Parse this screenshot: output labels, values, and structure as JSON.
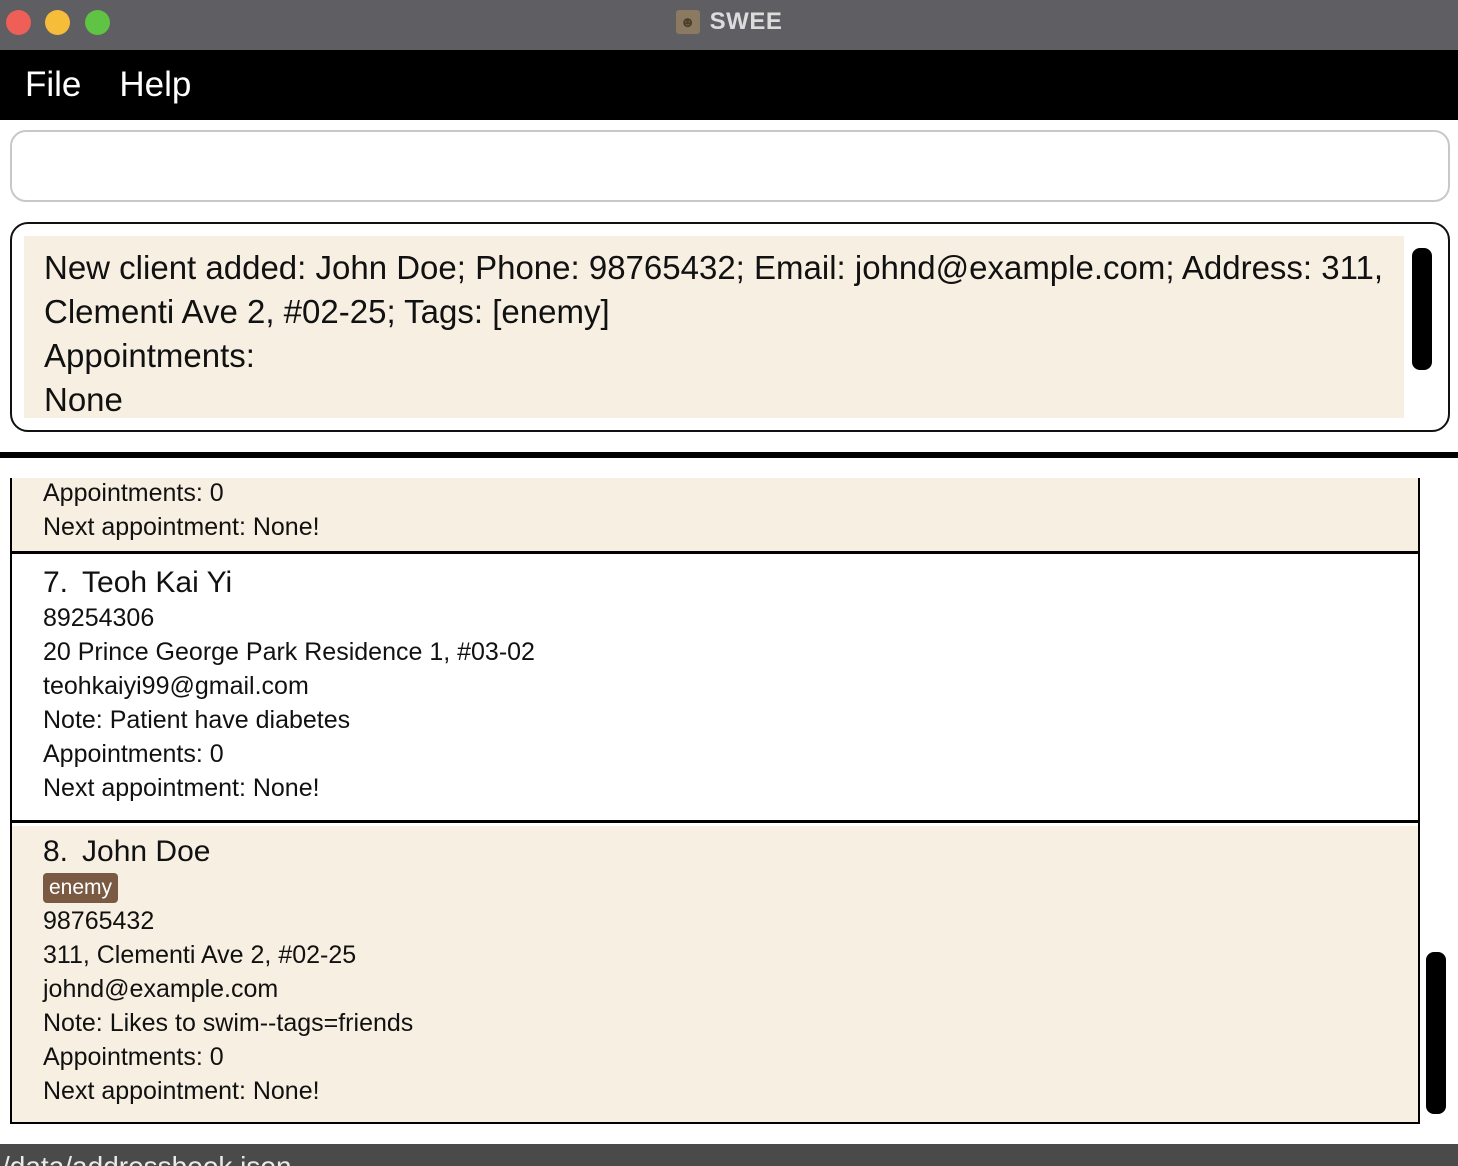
{
  "window": {
    "title": "SWEE",
    "icon": "contact-book-icon"
  },
  "menu": {
    "file_label": "File",
    "help_label": "Help"
  },
  "command": {
    "value": "",
    "placeholder": ""
  },
  "result": {
    "text": "New client added: John Doe; Phone: 98765432; Email: johnd@example.com; Address: 311, Clementi Ave 2, #02-25; Tags: [enemy]\nAppointments:\nNone"
  },
  "persons": {
    "partial": {
      "appointments": "Appointments: 0",
      "next_appointment": "Next appointment: None!"
    },
    "items": [
      {
        "index": "7.",
        "name": "Teoh Kai Yi",
        "phone": "89254306",
        "address": "20 Prince George Park Residence 1, #03-02",
        "email": "teohkaiyi99@gmail.com",
        "note": "Note: Patient have diabetes",
        "appointments": "Appointments: 0",
        "next_appointment": "Next appointment: None!"
      },
      {
        "index": "8.",
        "name": "John Doe",
        "tags": [
          "enemy"
        ],
        "phone": "98765432",
        "address": "311, Clementi Ave 2, #02-25",
        "email": "johnd@example.com",
        "note": "Note: Likes to swim--tags=friends",
        "appointments": "Appointments: 0",
        "next_appointment": "Next appointment: None!"
      }
    ]
  },
  "status": {
    "path": "/data/addressbook.json"
  },
  "colors": {
    "titlebar": "#5f5e62",
    "menubar": "#000000",
    "card_beige": "#f7efe2",
    "tag": "#7a5a43"
  }
}
